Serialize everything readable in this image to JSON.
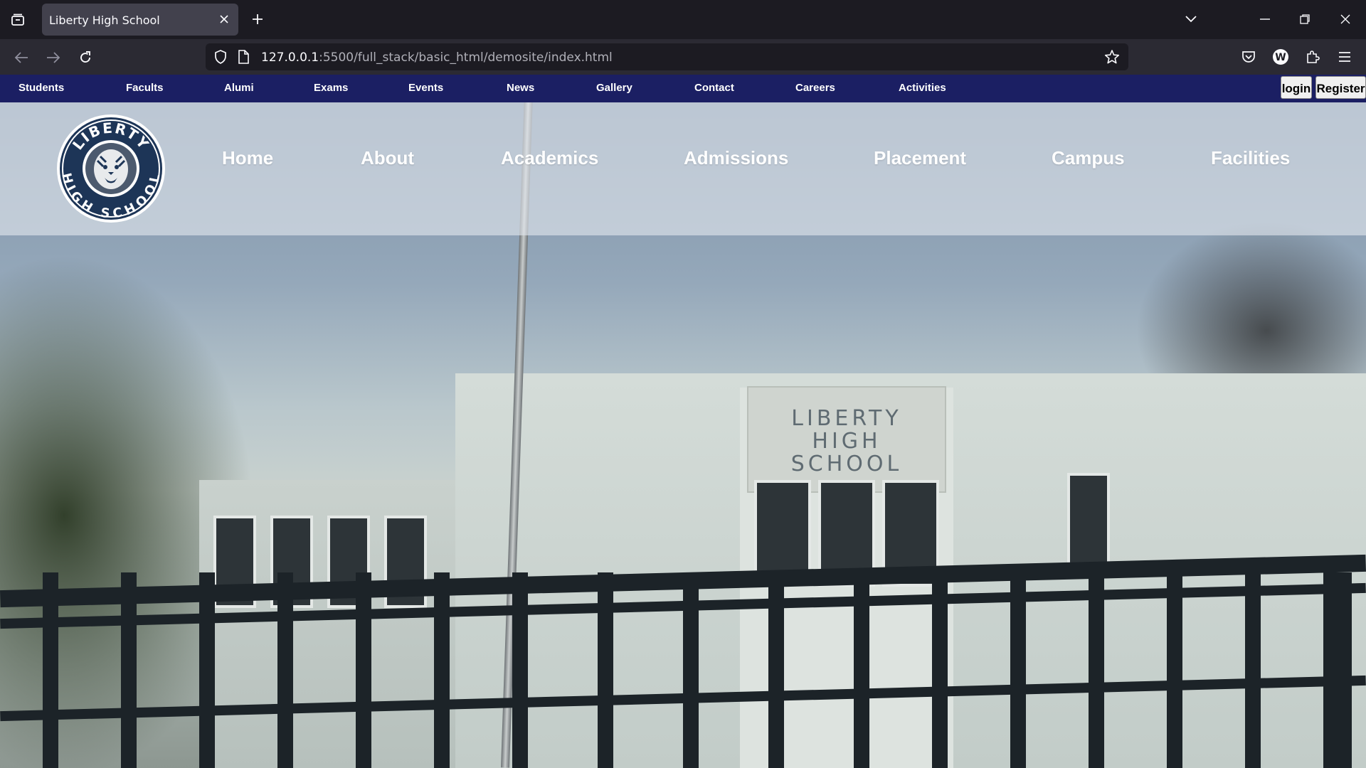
{
  "browser": {
    "tab_title": "Liberty High School",
    "url_host": "127.0.0.1",
    "url_rest": ":5500/full_stack/basic_html/demosite/index.html"
  },
  "site": {
    "top_links": [
      "Students",
      "Facults",
      "Alumi",
      "Exams",
      "Events",
      "News",
      "Gallery",
      "Contact",
      "Careers",
      "Activities"
    ],
    "login_label": "login",
    "register_label": "Register",
    "logo_text_top": "LIBERTY",
    "logo_text_bottom": "HIGH SCHOOL",
    "main_links": [
      "Home",
      "About",
      "Academics",
      "Admissions",
      "Placement",
      "Campus",
      "Facilities"
    ]
  },
  "hero": {
    "building_sign": "LIBERTY\nHIGH\nSCHOOL"
  },
  "colors": {
    "topnav_bg": "#1b1f63",
    "chrome_bg": "#1c1b22"
  }
}
